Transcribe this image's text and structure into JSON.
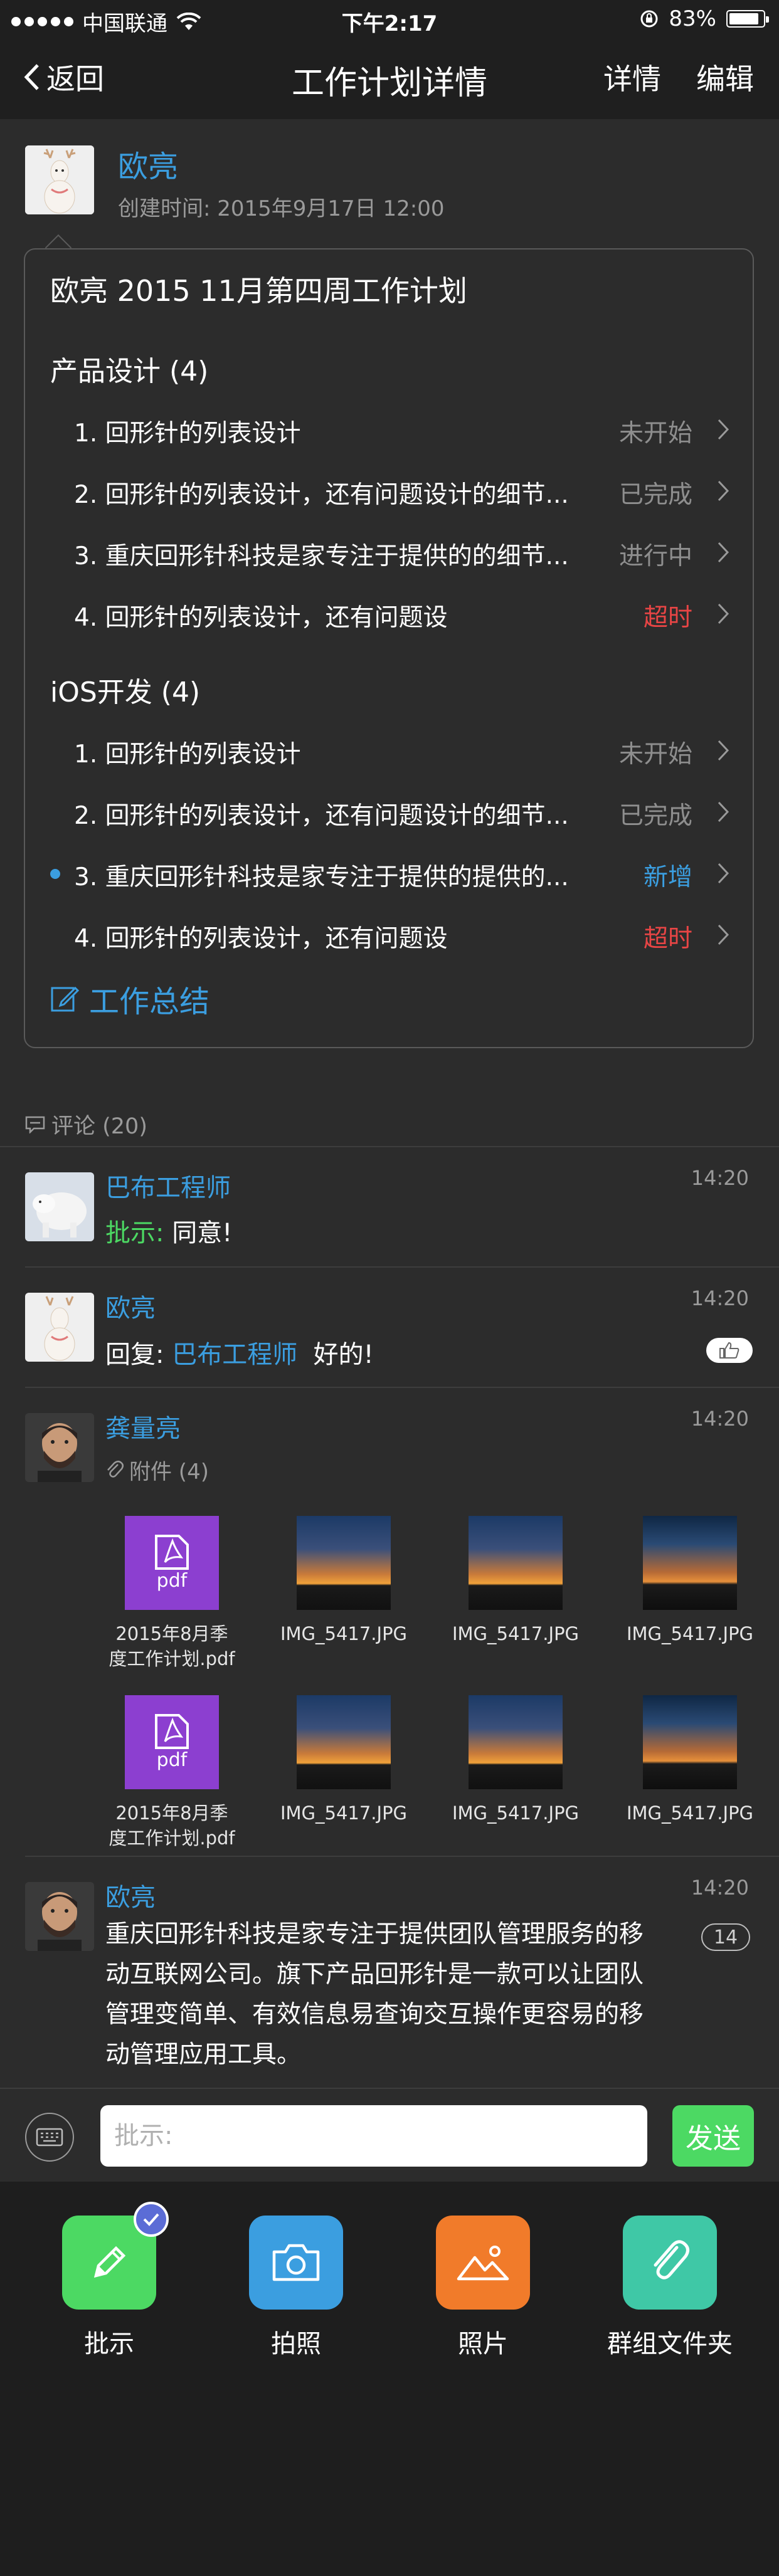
{
  "status_bar": {
    "carrier": "中国联通",
    "time": "下午2:17",
    "battery": "83%"
  },
  "nav": {
    "back_label": "返回",
    "title": "工作计划详情",
    "details_label": "详情",
    "edit_label": "编辑"
  },
  "author": {
    "name": "欧亮",
    "created": "创建时间: 2015年9月17日  12:00"
  },
  "plan": {
    "title": "欧亮 2015 11月第四周工作计划",
    "sections": [
      {
        "heading": "产品设计 (4)",
        "tasks": [
          {
            "text": "1. 回形针的列表设计",
            "status": "未开始"
          },
          {
            "text": "2. 回形针的列表设计，还有问题设计的细节...",
            "status": "已完成"
          },
          {
            "text": "3. 重庆回形针科技是家专注于提供的的细节...",
            "status": "进行中"
          },
          {
            "text": "4. 回形针的列表设计，还有问题设",
            "status": "超时"
          }
        ]
      },
      {
        "heading": "iOS开发 (4)",
        "tasks": [
          {
            "text": "1. 回形针的列表设计",
            "status": "未开始"
          },
          {
            "text": "2. 回形针的列表设计，还有问题设计的细节...",
            "status": "已完成"
          },
          {
            "text": "3. 重庆回形针科技是家专注于提供的提供的...",
            "status": "新增"
          },
          {
            "text": "4. 回形针的列表设计，还有问题设",
            "status": "超时"
          }
        ]
      }
    ],
    "summary_label": "工作总结"
  },
  "comments": {
    "header": "评论 (20)",
    "items": [
      {
        "name": "巴布工程师",
        "time": "14:20",
        "prefix": "批示:",
        "text": "同意!"
      },
      {
        "name": "欧亮",
        "time": "14:20",
        "prefix": "回复:",
        "mention": "巴布工程师",
        "text": "好的!"
      },
      {
        "name": "龚量亮",
        "time": "14:20",
        "attachments_label": "附件 (4)"
      },
      {
        "name": "欧亮",
        "time": "14:20",
        "count": "14",
        "lines": [
          "重庆回形针科技是家专注于提供团队管理服务的移",
          "动互联网公司。旗下产品回形针是一款可以让团队",
          "管理变简单、有效信息易查询交互操作更容易的移",
          "动管理应用工具。"
        ]
      }
    ]
  },
  "attachments": {
    "pdf_label": "pdf",
    "pdf_name_line1": "2015年8月季",
    "pdf_name_line2": "度工作计划.pdf",
    "photo_name": "IMG_5417.JPG"
  },
  "input_bar": {
    "placeholder": "批示:",
    "send_label": "发送"
  },
  "actions": [
    {
      "label": "批示",
      "color": "#4cd963",
      "icon": "pencil-icon"
    },
    {
      "label": "拍照",
      "color": "#3b9ee0",
      "icon": "camera-icon"
    },
    {
      "label": "照片",
      "color": "#f17b2a",
      "icon": "image-icon"
    },
    {
      "label": "群组文件夹",
      "color": "#3fc8a6",
      "icon": "paperclip-icon"
    }
  ],
  "colors": {
    "accent_blue": "#3b9ee0",
    "status_red": "#e84545",
    "status_grey": "#8e8e8e",
    "pdf_purple": "#8c3fd0",
    "send_green": "#4cd963"
  }
}
